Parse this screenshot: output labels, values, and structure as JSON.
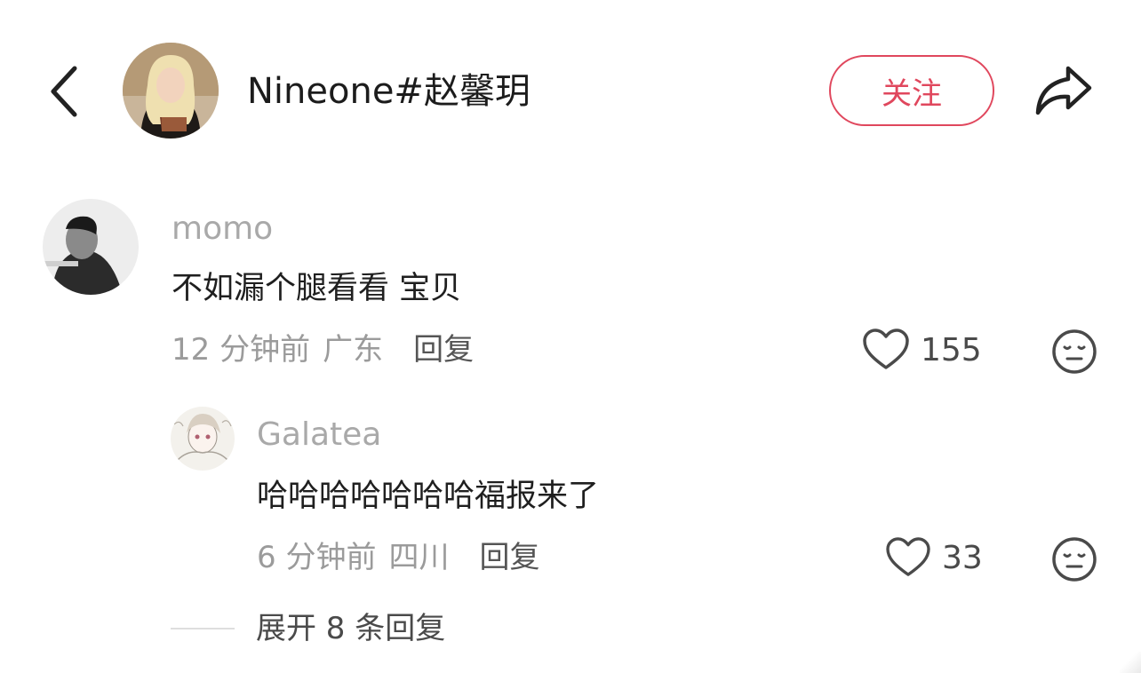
{
  "header": {
    "title": "Nineone#赵馨玥",
    "follow_label": "关注",
    "icons": {
      "back": "chevron-left-icon",
      "share": "share-arrow-icon"
    }
  },
  "comments": [
    {
      "username": "momo",
      "text": "不如漏个腿看看 宝贝",
      "time": "12 分钟前",
      "location": "广东",
      "reply_label": "回复",
      "likes": "155"
    }
  ],
  "replies": [
    {
      "username": "Galatea",
      "text": "哈哈哈哈哈哈哈福报来了",
      "time": "6 分钟前",
      "location": "四川",
      "reply_label": "回复",
      "likes": "33"
    }
  ],
  "expand_label": "展开 8 条回复",
  "colors": {
    "accent": "#e0475d",
    "username": "#a9a9a9",
    "meta": "#9b9b9b",
    "text": "#1f1f1f"
  }
}
